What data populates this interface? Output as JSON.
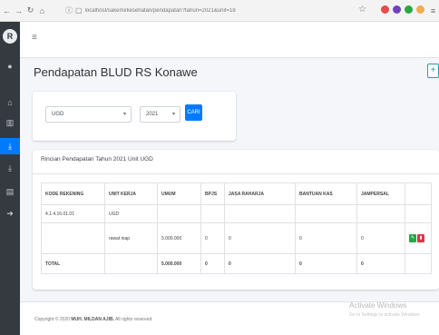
{
  "browser": {
    "url": "localhost/sakemi/kesehatan/pendapatan?tahun=2021&unit=18",
    "icons": [
      "back-icon",
      "forward-icon",
      "reload-icon",
      "home-icon",
      "info-icon",
      "page-icon",
      "star-icon"
    ]
  },
  "sidebar": {
    "logo": "R",
    "items": [
      "home-icon",
      "chart-icon",
      "download-icon",
      "download-icon",
      "report-icon",
      "logout-icon"
    ],
    "active_index": 2
  },
  "topbar": {
    "menu_icon": "≡"
  },
  "page": {
    "title": "Pendapatan BLUD RS Konawe",
    "add_label": "+"
  },
  "filters": {
    "unit_selected": "UGD",
    "year_selected": "2021",
    "search_label": "CARI"
  },
  "table_card": {
    "title": "Rincian Pendapatan Tahun 2021 Unit UGD",
    "columns": [
      "KODE REKENING",
      "UNIT KERJA",
      "UMUM",
      "BPJS",
      "JASA RAHARJA",
      "BANTUAN KAS",
      "JAMPERSAL",
      ""
    ],
    "rows": [
      [
        "4.1.4.16.01.01",
        "UGD",
        "",
        "",
        "",
        "",
        "",
        ""
      ],
      [
        "",
        "rawat inap",
        "5.000.000",
        "0",
        "0",
        "0",
        "0",
        ""
      ],
      [
        "TOTAL",
        "",
        "5.000.000",
        "0",
        "0",
        "0",
        "0",
        ""
      ]
    ]
  },
  "footer": {
    "prefix": "Copyright © 2020",
    "owner": "MUH. MILDAN AJIB.",
    "suffix": "All rights reserved."
  },
  "watermark": {
    "title": "Activate Windows",
    "subtitle": "Go to Settings to activate Windows."
  },
  "colors": {
    "sidebar": "#343a40",
    "primary": "#007bff",
    "success": "#28a745",
    "danger": "#dc3545",
    "info": "#17a2b8"
  }
}
